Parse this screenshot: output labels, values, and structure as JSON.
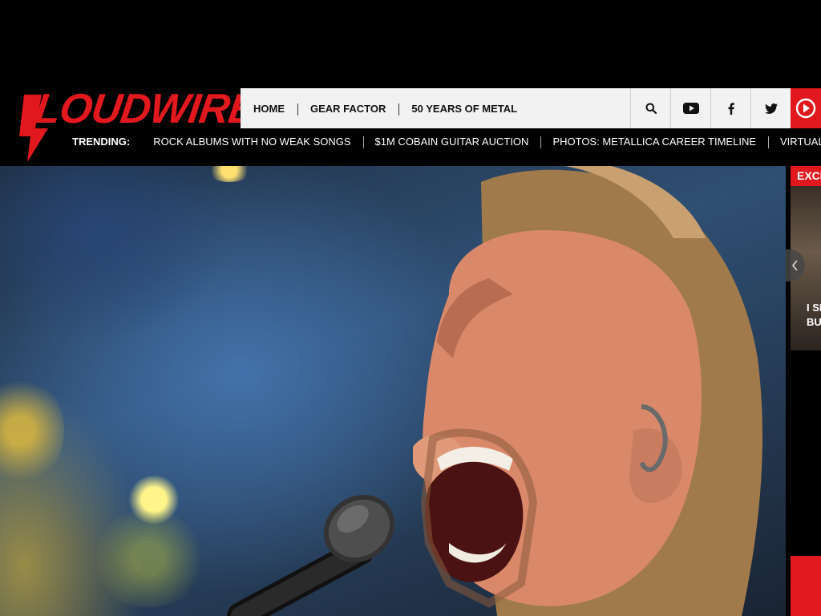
{
  "brand": {
    "logo_text": "LOUDWIRE",
    "color": "#e1191e"
  },
  "nav": {
    "links": [
      "HOME",
      "GEAR FACTOR",
      "50 YEARS OF METAL"
    ],
    "icons": [
      "search-icon",
      "youtube-icon",
      "facebook-icon",
      "twitter-icon",
      "listen-play-icon"
    ]
  },
  "trending": {
    "label": "TRENDING:",
    "items": [
      "ROCK ALBUMS WITH NO WEAK SONGS",
      "$1M COBAIN GUITAR AUCTION",
      "PHOTOS: METALLICA CAREER TIMELINE",
      "VIRTUAL CONCERT CALENDAR"
    ]
  },
  "sidebar": {
    "tag": "EXCLUSIVE",
    "card_text_line1": "I SI",
    "card_text_line2": "BUT"
  }
}
